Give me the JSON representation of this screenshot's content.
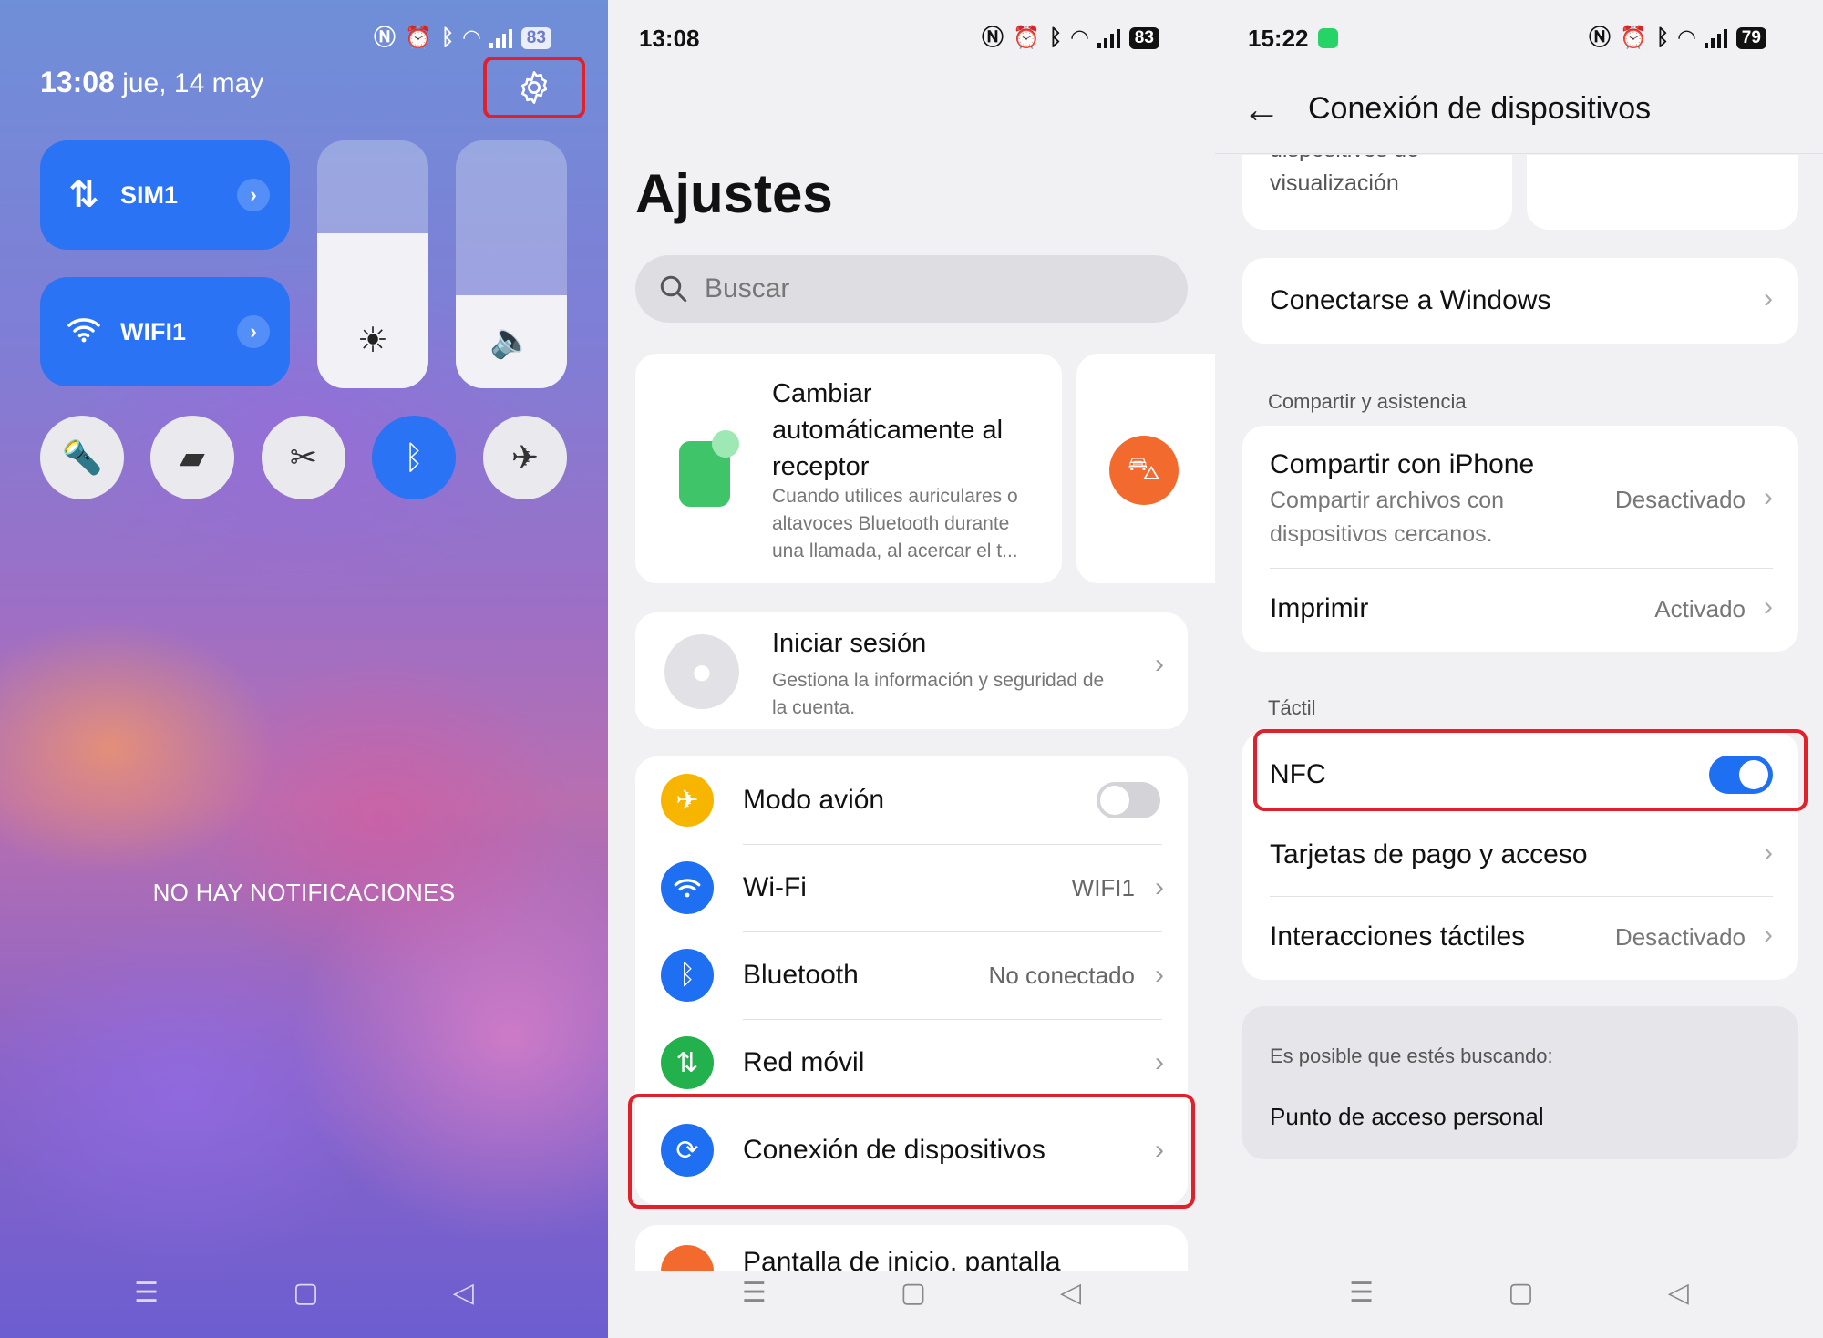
{
  "panel1": {
    "status_battery": "83",
    "time": "13:08",
    "date": "jue, 14 may",
    "tiles": {
      "sim": "SIM1",
      "wifi": "WIFI1"
    },
    "no_notifications": "NO HAY NOTIFICACIONES"
  },
  "panel2": {
    "status_time": "13:08",
    "status_battery": "83",
    "title": "Ajustes",
    "search_placeholder": "Buscar",
    "suggestion": {
      "title": "Cambiar automáticamente al receptor",
      "desc": "Cuando utilices auriculares o altavoces Bluetooth durante una llamada, al acercar el t..."
    },
    "account": {
      "title": "Iniciar sesión",
      "desc": "Gestiona la información y seguridad de la cuenta."
    },
    "items": [
      {
        "label": "Modo avión",
        "value": ""
      },
      {
        "label": "Wi-Fi",
        "value": "WIFI1"
      },
      {
        "label": "Bluetooth",
        "value": "No conectado"
      },
      {
        "label": "Red móvil",
        "value": ""
      },
      {
        "label": "Conexión de dispositivos",
        "value": ""
      }
    ],
    "partial_item": "Pantalla de inicio, pantalla"
  },
  "panel3": {
    "status_time": "15:22",
    "status_battery": "79",
    "title": "Conexión de dispositivos",
    "partial_card": "dispositivos de visualización",
    "connect_windows": "Conectarse a Windows",
    "section_share": "Compartir y asistencia",
    "share_iphone": {
      "title": "Compartir con iPhone",
      "desc": "Compartir archivos con dispositivos cercanos.",
      "value": "Desactivado"
    },
    "print": {
      "title": "Imprimir",
      "value": "Activado"
    },
    "section_touch": "Táctil",
    "nfc": {
      "label": "NFC",
      "enabled": true
    },
    "cards": "Tarjetas de pago y acceso",
    "touch_interactions": {
      "label": "Interacciones táctiles",
      "value": "Desactivado"
    },
    "suggest": {
      "header": "Es posible que estés buscando:",
      "item": "Punto de acceso personal"
    }
  },
  "colors": {
    "accent": "#2a73f5",
    "highlight": "#e0202a",
    "toggle_on": "#1f6ff2"
  }
}
